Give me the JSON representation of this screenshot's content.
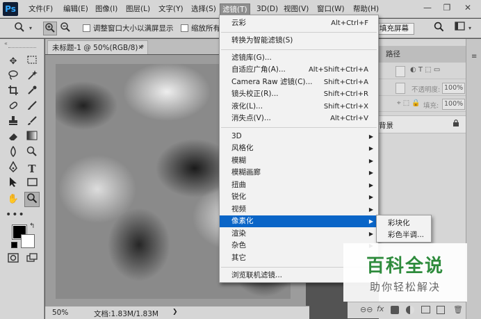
{
  "app": {
    "logo": "Ps"
  },
  "menubar": {
    "items": [
      "文件(F)",
      "编辑(E)",
      "图像(I)",
      "图层(L)",
      "文字(Y)",
      "选择(S)",
      "滤镜(T)",
      "3D(D)",
      "视图(V)",
      "窗口(W)",
      "帮助(H)"
    ],
    "active": "滤镜(T)"
  },
  "window_controls": {
    "minimize": "—",
    "restore": "❐",
    "close": "✕"
  },
  "options": {
    "resize_windows_label": "调整窗口大小以满屏显示",
    "zoom_all_label": "缩放所有",
    "fill_screen_label": "填充屏幕"
  },
  "document": {
    "tab_title": "未标题-1 @ 50%(RGB/8) *",
    "close_glyph": "✕"
  },
  "status": {
    "zoom": "50%",
    "doc_size": "文档:1.83M/1.83M",
    "arrow": "❯"
  },
  "panel": {
    "paths_tab": "路径",
    "opacity_label": "不透明度:",
    "opacity_value": "100%",
    "fill_label": "填充:",
    "fill_value": "100%",
    "layer_name": "背景"
  },
  "filter_menu": {
    "sections": [
      [
        {
          "label": "云彩",
          "shortcut": "Alt+Ctrl+F"
        }
      ],
      [
        {
          "label": "转换为智能滤镜(S)",
          "shortcut": ""
        }
      ],
      [
        {
          "label": "滤镜库(G)...",
          "shortcut": ""
        },
        {
          "label": "自适应广角(A)...",
          "shortcut": "Alt+Shift+Ctrl+A"
        },
        {
          "label": "Camera Raw 滤镜(C)...",
          "shortcut": "Shift+Ctrl+A"
        },
        {
          "label": "镜头校正(R)...",
          "shortcut": "Shift+Ctrl+R"
        },
        {
          "label": "液化(L)...",
          "shortcut": "Shift+Ctrl+X"
        },
        {
          "label": "消失点(V)...",
          "shortcut": "Alt+Ctrl+V"
        }
      ],
      [
        {
          "label": "3D",
          "submenu": true
        },
        {
          "label": "风格化",
          "submenu": true
        },
        {
          "label": "模糊",
          "submenu": true
        },
        {
          "label": "模糊画廊",
          "submenu": true
        },
        {
          "label": "扭曲",
          "submenu": true
        },
        {
          "label": "锐化",
          "submenu": true
        },
        {
          "label": "视频",
          "submenu": true
        },
        {
          "label": "像素化",
          "submenu": true,
          "highlighted": true
        },
        {
          "label": "渲染",
          "submenu": true
        },
        {
          "label": "杂色",
          "submenu": true
        },
        {
          "label": "其它",
          "submenu": true
        }
      ],
      [
        {
          "label": "浏览联机滤镜...",
          "shortcut": ""
        }
      ]
    ]
  },
  "pixelate_submenu": {
    "items": [
      "彩块化",
      "彩色半调..."
    ]
  },
  "watermark": {
    "title": "百科全说",
    "subtitle": "助你轻松解决"
  },
  "colors": {
    "highlight": "#0a65c7",
    "watermark_green": "#2e8b3c"
  }
}
